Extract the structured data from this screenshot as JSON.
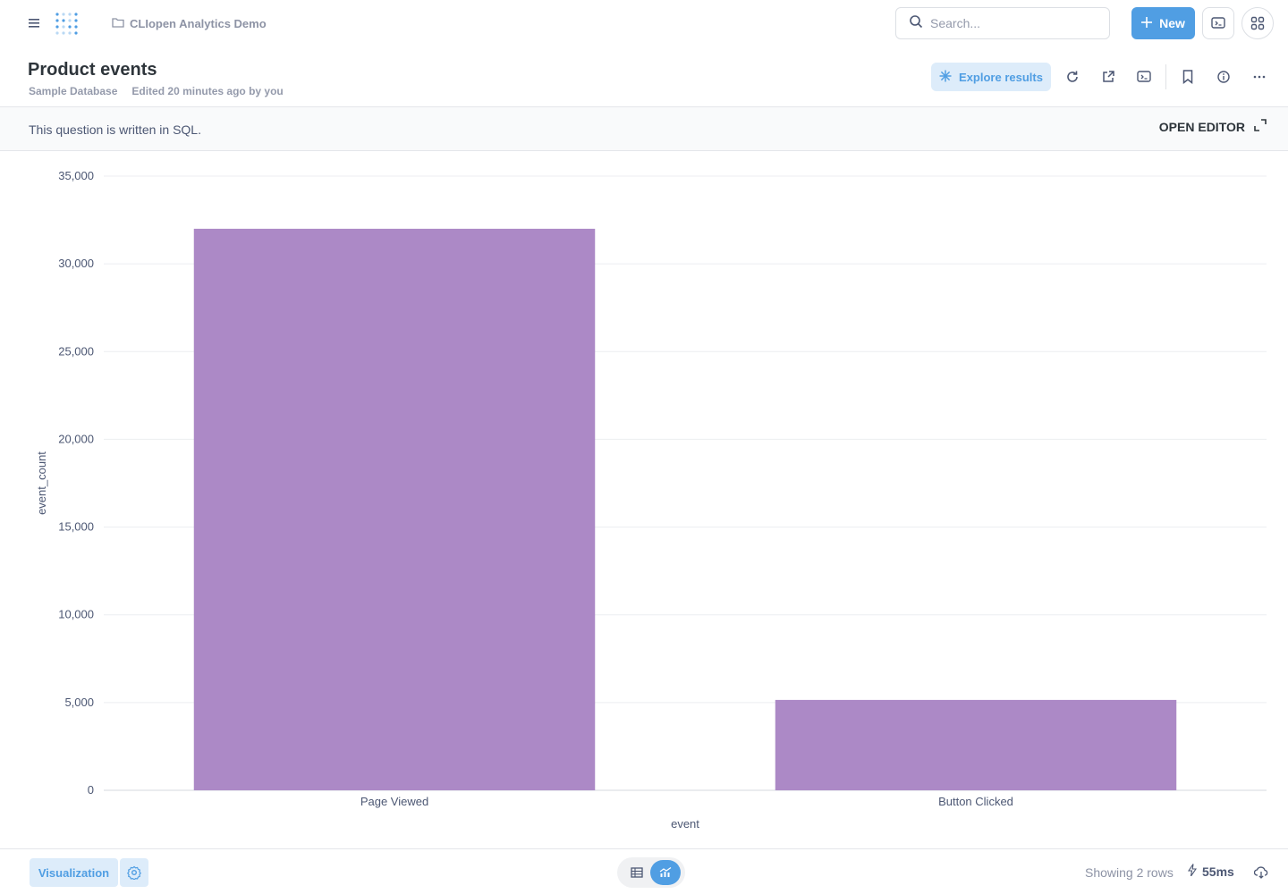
{
  "header": {
    "collection": "CLIopen Analytics Demo",
    "search_placeholder": "Search...",
    "new_label": "New"
  },
  "question": {
    "title": "Product events",
    "database": "Sample Database",
    "edited": "Edited 20 minutes ago by you",
    "explore_label": "Explore results"
  },
  "sql_bar": {
    "message": "This question is written in SQL.",
    "open_editor_label": "OPEN EDITOR"
  },
  "footer": {
    "visualization_label": "Visualization",
    "rows_text": "Showing 2 rows",
    "timing": "55ms"
  },
  "colors": {
    "accent": "#509ee3",
    "bar": "#ac89c6"
  },
  "icons": [
    "menu-icon",
    "logo-icon",
    "folder-icon",
    "search-icon",
    "plus-icon",
    "model-icon",
    "apps-icon",
    "sparkle-icon",
    "refresh-icon",
    "share-icon",
    "embed-icon",
    "bookmark-icon",
    "info-icon",
    "more-icon",
    "expand-icon",
    "gear-icon",
    "table-icon",
    "chart-icon",
    "bolt-icon",
    "download-icon"
  ],
  "chart_data": {
    "type": "bar",
    "categories": [
      "Page Viewed",
      "Button Clicked"
    ],
    "values": [
      32000,
      5150
    ],
    "xlabel": "event",
    "ylabel": "event_count",
    "ylim": [
      0,
      35000
    ],
    "yticks": [
      "0",
      "5,000",
      "10,000",
      "15,000",
      "20,000",
      "25,000",
      "30,000",
      "35,000"
    ],
    "grid": true
  }
}
